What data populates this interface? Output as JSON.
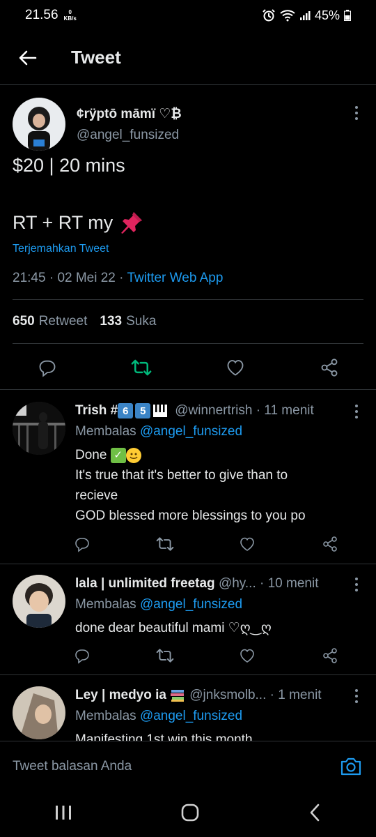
{
  "status_bar": {
    "time": "21.56",
    "net_value": "0",
    "net_unit": "KB/s",
    "battery": "45%"
  },
  "header": {
    "title": "Tweet"
  },
  "tweet": {
    "name": "¢rÿptō māmï ♡₿",
    "handle": "@angel_funsized",
    "line1": "$20 | 20 mins",
    "line2": "RT + RT my",
    "translate": "Terjemahkan Tweet",
    "time": "21:45",
    "sep1": " · ",
    "date": "02 Mei 22",
    "sep2": " · ",
    "source": "Twitter Web App",
    "retweets_count": "650",
    "retweets_label": "Retweet",
    "likes_count": "133",
    "likes_label": "Suka"
  },
  "replies": [
    {
      "name": "Trish #",
      "chip1": "6",
      "chip2": "5",
      "handle": "@winnertrish",
      "time": "· 11 menit",
      "replying_prefix": "Membalas",
      "replying_to": "@angel_funsized",
      "lines": [
        "Done",
        "It's true that it's better to give than to",
        "recieve",
        "GOD blessed more blessings to you po"
      ]
    },
    {
      "name": "lala | unlimited freetag",
      "handle": "@hy...",
      "time": "· 10 menit",
      "replying_prefix": "Membalas",
      "replying_to": "@angel_funsized",
      "lines": [
        "done dear beautiful mami ♡ღ‿ღ"
      ]
    },
    {
      "name": "Ley | medyo ia",
      "handle": "@jnksmolb...",
      "time": "· 1 menit",
      "replying_prefix": "Membalas",
      "replying_to": "@angel_funsized",
      "lines": [
        "Manifesting 1st win this month"
      ]
    }
  ],
  "compose": {
    "placeholder": "Tweet balasan Anda"
  },
  "colors": {
    "accent": "#1d9bf0",
    "retweet_active": "#00ba7c",
    "muted": "#8b98a5",
    "divider": "#2f3336"
  }
}
